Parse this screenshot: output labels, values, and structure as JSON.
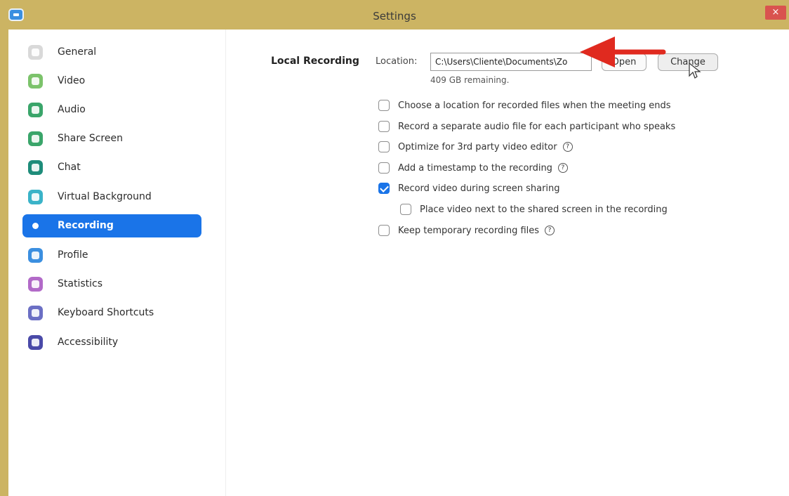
{
  "window": {
    "title": "Settings",
    "close_glyph": "×"
  },
  "sidebar": {
    "items": [
      {
        "label": "General",
        "icon": "gear-icon",
        "color": "#d9d9d9"
      },
      {
        "label": "Video",
        "icon": "video-icon",
        "color": "#7cc36b"
      },
      {
        "label": "Audio",
        "icon": "headphones-icon",
        "color": "#3aa56a"
      },
      {
        "label": "Share Screen",
        "icon": "share-screen-icon",
        "color": "#3aa56a"
      },
      {
        "label": "Chat",
        "icon": "chat-icon",
        "color": "#1e8c7a"
      },
      {
        "label": "Virtual Background",
        "icon": "virtual-background-icon",
        "color": "#3ab3c8"
      },
      {
        "label": "Recording",
        "icon": "record-icon",
        "color": "#1a74e8",
        "active": true
      },
      {
        "label": "Profile",
        "icon": "profile-icon",
        "color": "#3b8fe0"
      },
      {
        "label": "Statistics",
        "icon": "statistics-icon",
        "color": "#b26ac8"
      },
      {
        "label": "Keyboard Shortcuts",
        "icon": "keyboard-icon",
        "color": "#6b6fc4"
      },
      {
        "label": "Accessibility",
        "icon": "accessibility-icon",
        "color": "#4a4aa8"
      }
    ]
  },
  "recording": {
    "section_label": "Local Recording",
    "location_label": "Location:",
    "location_value": "C:\\Users\\Cliente\\Documents\\Zo",
    "open_label": "Open",
    "change_label": "Change",
    "remaining": "409 GB remaining.",
    "options": [
      {
        "label": "Choose a location for recorded files when the meeting ends",
        "checked": false,
        "info": false,
        "indent": false
      },
      {
        "label": "Record a separate audio file for each participant who speaks",
        "checked": false,
        "info": false,
        "indent": false
      },
      {
        "label": "Optimize for 3rd party video editor",
        "checked": false,
        "info": true,
        "indent": false
      },
      {
        "label": "Add a timestamp to the recording",
        "checked": false,
        "info": true,
        "indent": false
      },
      {
        "label": "Record video during screen sharing",
        "checked": true,
        "info": false,
        "indent": false
      },
      {
        "label": "Place video next to the shared screen in the recording",
        "checked": false,
        "info": false,
        "indent": true
      },
      {
        "label": "Keep temporary recording files",
        "checked": false,
        "info": true,
        "indent": false
      }
    ],
    "info_glyph": "?"
  },
  "colors": {
    "titlebar": "#ccb463",
    "accent": "#1a74e8",
    "arrow": "#e02a1f"
  }
}
